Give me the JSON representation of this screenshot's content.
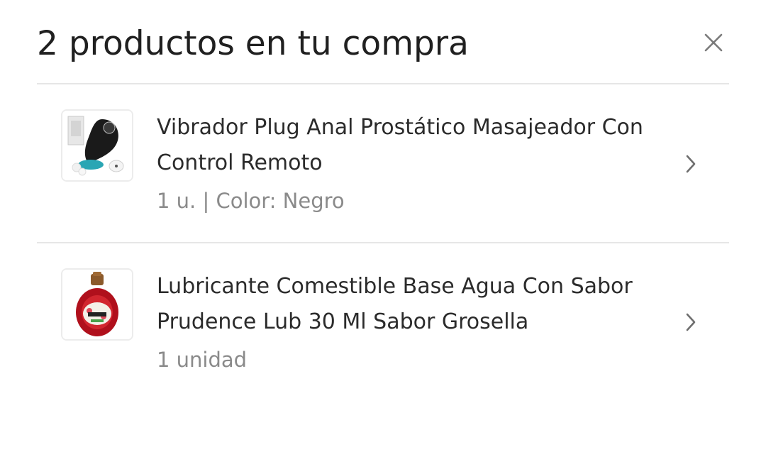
{
  "header": {
    "title": "2 productos en tu compra",
    "close_icon": "close-icon"
  },
  "items": [
    {
      "title_line1": "Vibrador Plug Anal Prostático Masajeador Con",
      "title_line2": "Control Remoto",
      "meta": "1 u. | Color: Negro",
      "icon": "chevron-right-icon"
    },
    {
      "title_line1": "Lubricante Comestible Base Agua Con Sabor",
      "title_line2": "Prudence Lub 30 Ml Sabor Grosella",
      "meta": "1 unidad",
      "icon": "chevron-right-icon"
    }
  ],
  "colors": {
    "title": "#202020",
    "meta": "#8a8a8a",
    "divider": "#e6e6e6"
  }
}
